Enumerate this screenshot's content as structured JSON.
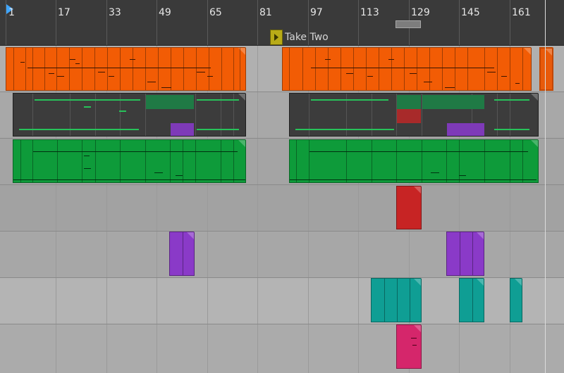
{
  "ruler": {
    "bars": [
      "1",
      "17",
      "33",
      "49",
      "65",
      "81",
      "97",
      "113",
      "129",
      "145",
      "161"
    ]
  },
  "cue": {
    "label": "Take Two"
  },
  "colors": {
    "orange": "#f25c05",
    "green": "#0e9b3a",
    "dark": "#3c3c3c",
    "red": "#c72424",
    "purple": "#8a3ac8",
    "teal": "#0f9e94",
    "pink": "#d5266b",
    "playhead": "#3fa6ff",
    "cue": "#b8ab17"
  }
}
